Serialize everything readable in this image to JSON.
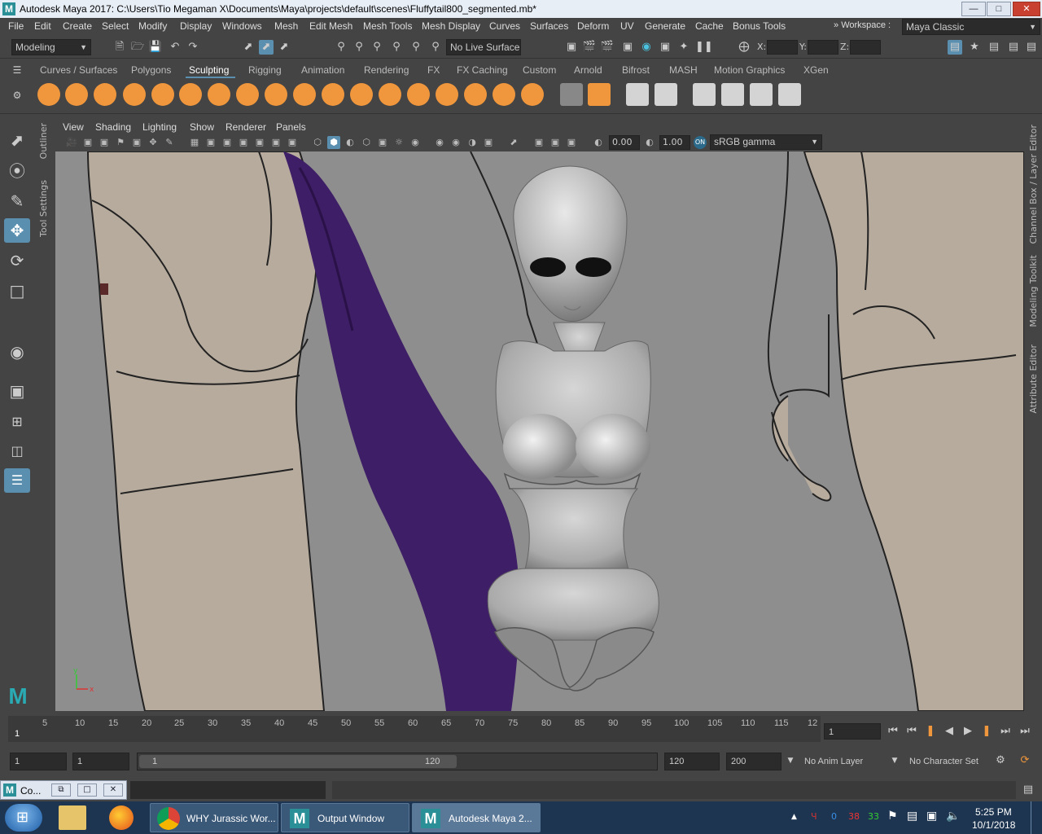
{
  "window": {
    "title": "Autodesk Maya 2017: C:\\Users\\Tio Megaman X\\Documents\\Maya\\projects\\default\\scenes\\Fluffytail800_segmented.mb*",
    "logo": "M"
  },
  "menubar": {
    "items": [
      "File",
      "Edit",
      "Create",
      "Select",
      "Modify",
      "Display",
      "Windows",
      "Mesh",
      "Edit Mesh",
      "Mesh Tools",
      "Mesh Display",
      "Curves",
      "Surfaces",
      "Deform",
      "UV",
      "Generate",
      "Cache",
      "Bonus Tools"
    ],
    "workspace_label": "Workspace :",
    "workspace_value": "Maya Classic"
  },
  "statusline": {
    "mode": "Modeling",
    "live_surface": "No Live Surface",
    "x_label": "X:",
    "y_label": "Y:",
    "z_label": "Z:"
  },
  "shelf": {
    "tabs": [
      "Curves / Surfaces",
      "Polygons",
      "Sculpting",
      "Rigging",
      "Animation",
      "Rendering",
      "FX",
      "FX Caching",
      "Custom",
      "Arnold",
      "Bifrost",
      "MASH",
      "Motion Graphics",
      "XGen"
    ],
    "active_tab": "Sculpting"
  },
  "side_tabs": {
    "outliner": "Outliner",
    "tool_settings": "Tool Settings"
  },
  "right_tabs": {
    "channel_box": "Channel Box / Layer Editor",
    "modeling_toolkit": "Modeling Toolkit",
    "attribute_editor": "Attribute Editor"
  },
  "panel": {
    "menus": [
      "View",
      "Shading",
      "Lighting",
      "Show",
      "Renderer",
      "Panels"
    ],
    "exposure": "0.00",
    "gamma": "1.00",
    "colorspace": "sRGB gamma"
  },
  "timeline": {
    "ticks": [
      "5",
      "10",
      "15",
      "20",
      "25",
      "30",
      "35",
      "40",
      "45",
      "50",
      "55",
      "60",
      "65",
      "70",
      "75",
      "80",
      "85",
      "90",
      "95",
      "100",
      "105",
      "110",
      "115",
      "12"
    ],
    "start_mark": "1",
    "current_frame": "1"
  },
  "range": {
    "start": "1",
    "playback_start": "1",
    "slider_start": "1",
    "slider_end": "120",
    "playback_end": "120",
    "end": "200",
    "anim_layer": "No Anim Layer",
    "character_set": "No Character Set"
  },
  "cmdline": {
    "script_label": "Co..."
  },
  "taskbar": {
    "tasks": [
      "WHY Jurassic Wor...",
      "Output Window",
      "Autodesk Maya 2..."
    ],
    "time": "5:25 PM",
    "date": "10/1/2018",
    "tray_numbers": [
      "0",
      "38",
      "33"
    ]
  }
}
